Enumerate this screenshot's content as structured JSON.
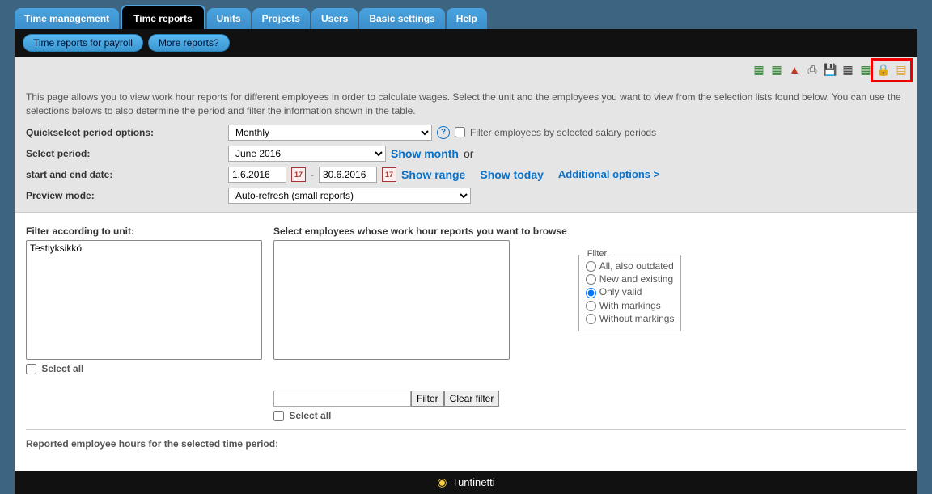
{
  "tabs": [
    "Time management",
    "Time reports",
    "Units",
    "Projects",
    "Users",
    "Basic settings",
    "Help"
  ],
  "active_tab": 1,
  "subtabs": [
    "Time reports for payroll",
    "More reports?"
  ],
  "intro": "This page allows you to view work hour reports for different employees in order to calculate wages. Select the unit and the employees you want to view from the selection lists found below. You can use the selections belows to also determine the period and filter the information shown in the table.",
  "form": {
    "quickselect_label": "Quickselect period options:",
    "quickselect_value": "Monthly",
    "filter_salary_label": "Filter employees by selected salary periods",
    "period_label": "Select period:",
    "period_value": "June 2016",
    "show_month": "Show month",
    "or": "or",
    "date_label": "start and end date:",
    "date_start": "1.6.2016",
    "date_end": "30.6.2016",
    "dash": "-",
    "show_range": "Show range",
    "show_today": "Show today",
    "additional": "Additional options >",
    "preview_label": "Preview mode:",
    "preview_value": "Auto-refresh (small reports)"
  },
  "unit_section": {
    "label": "Filter according to unit:",
    "items": [
      "Testiyksikkö"
    ],
    "select_all": "Select all"
  },
  "emp_section": {
    "label": "Select employees whose work hour reports you want to browse",
    "select_all": "Select all",
    "filter_btn": "Filter",
    "clear_btn": "Clear filter"
  },
  "filter_radio": {
    "legend": "Filter",
    "opts": [
      "All, also outdated",
      "New and existing",
      "Only valid",
      "With markings",
      "Without markings"
    ],
    "selected": 2
  },
  "reported_label": "Reported employee hours for the selected time period:",
  "footer": "Tuntinetti",
  "cal_text": "17"
}
